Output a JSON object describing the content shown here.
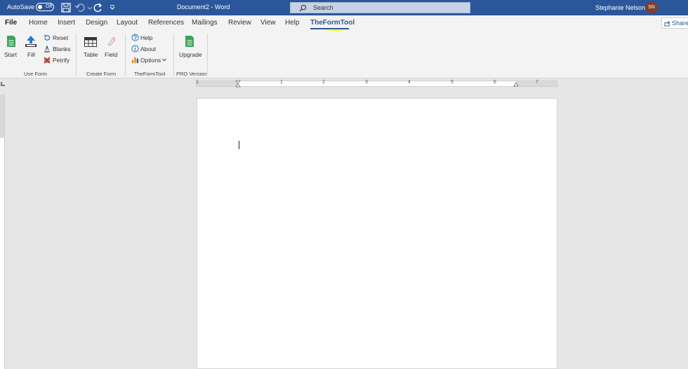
{
  "titlebar": {
    "autosave_label": "AutoSave",
    "autosave_state": "Off",
    "document_title": "Document2 - Word",
    "search_placeholder": "Search",
    "user_name": "Stephanie Nelson",
    "user_initials": "SN"
  },
  "tabs": {
    "file": "File",
    "home": "Home",
    "insert": "Insert",
    "design": "Design",
    "layout": "Layout",
    "references": "References",
    "mailings": "Mailings",
    "review": "Review",
    "view": "View",
    "help": "Help",
    "theformtool": "TheFormTool",
    "share": "Share"
  },
  "ribbon": {
    "use_form": {
      "label": "Use Form",
      "start": "Start",
      "fill": "Fill",
      "reset": "Reset",
      "blanks": "Blanks",
      "petrify": "Petrify"
    },
    "create_form": {
      "label": "Create Form",
      "table": "Table",
      "field": "Field"
    },
    "theformtool": {
      "label": "TheFormTool",
      "help": "Help",
      "about": "About",
      "options": "Options"
    },
    "pro": {
      "label": "PRO Version",
      "upgrade": "Upgrade"
    }
  },
  "ruler": {
    "numbers": [
      "1",
      "1",
      "2",
      "3",
      "4",
      "5",
      "6",
      "7"
    ]
  },
  "colors": {
    "brand": "#2b579a",
    "highlight": "#ffff00"
  }
}
